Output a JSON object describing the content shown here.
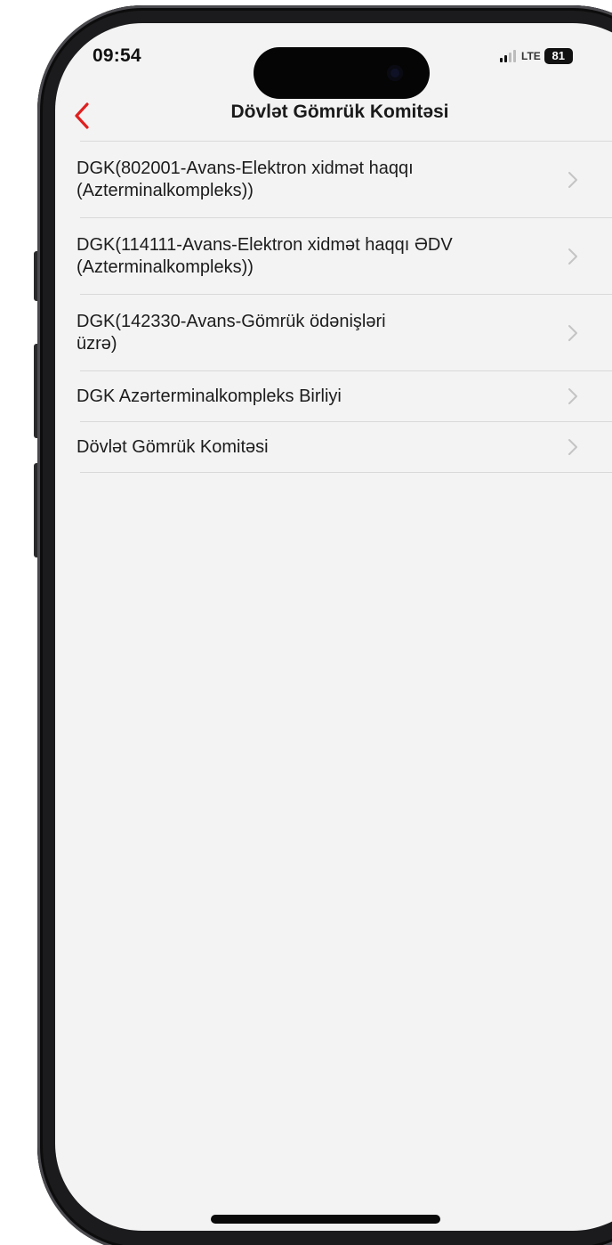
{
  "status_bar": {
    "time": "09:54",
    "network": "LTE",
    "battery": "81"
  },
  "nav": {
    "title": "Dövlət Gömrük Komitəsi",
    "back_icon": "chevron-left-icon",
    "accent_color": "#e02020"
  },
  "list": {
    "items": [
      {
        "label": "DGK(802001-Avans-Elektron xidmət haqqı (Azterminalkompleks))"
      },
      {
        "label": "DGK(114111-Avans-Elektron xidmət haqqı ƏDV (Azterminalkompleks))"
      },
      {
        "label": "DGK(142330-Avans-Gömrük ödənişləri üzrə)"
      },
      {
        "label": "DGK Azərterminalkompleks Birliyi"
      },
      {
        "label": "Dövlət Gömrük Komitəsi"
      }
    ],
    "disclosure_icon": "chevron-right-icon"
  }
}
